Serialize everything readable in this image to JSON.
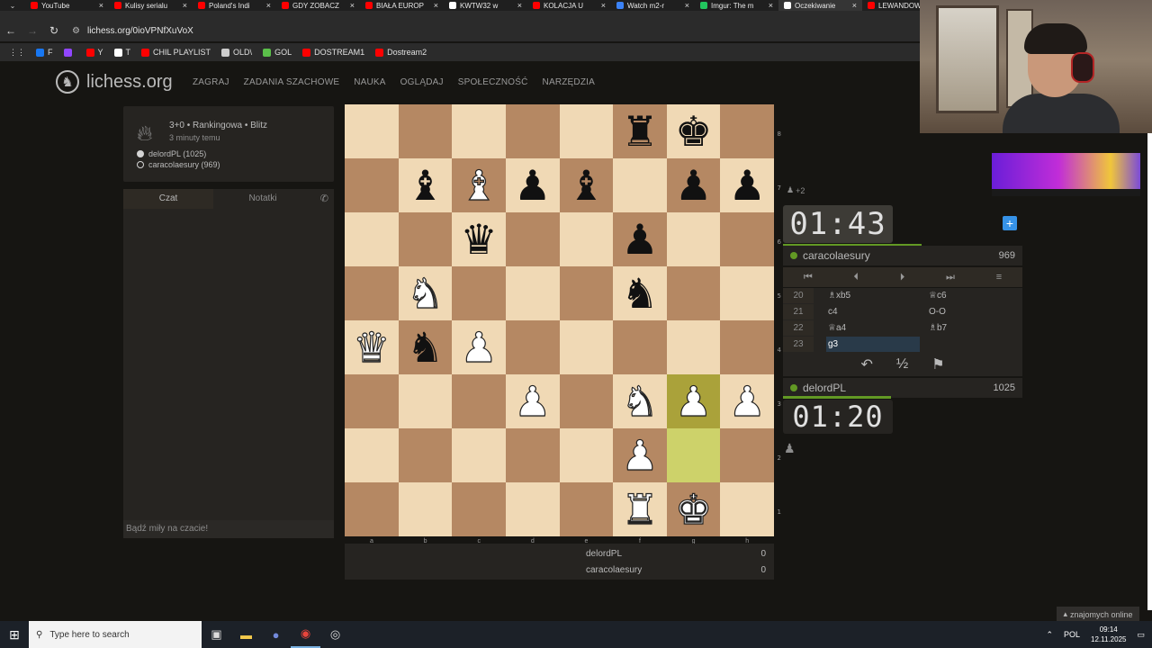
{
  "browser": {
    "tabs": [
      {
        "label": "YouTube",
        "color": "#ff0000",
        "active": false
      },
      {
        "label": "Kulisy serialu",
        "color": "#ff0000",
        "active": false
      },
      {
        "label": "Poland's Indi",
        "color": "#ff0000",
        "active": false
      },
      {
        "label": "GDY ZOBACZ",
        "color": "#ff0000",
        "active": false
      },
      {
        "label": "BIAŁA EUROP",
        "color": "#ff0000",
        "active": false
      },
      {
        "label": "KWTW32 w",
        "color": "#ffffff",
        "active": false
      },
      {
        "label": "KOLACJA U",
        "color": "#ff0000",
        "active": false
      },
      {
        "label": "Watch m2-r",
        "color": "#3b82f6",
        "active": false
      },
      {
        "label": "Imgur: The m",
        "color": "#22c55e",
        "active": false
      },
      {
        "label": "Oczekiwanie",
        "color": "#ffffff",
        "active": true
      },
      {
        "label": "LEWANDOW",
        "color": "#ff0000",
        "active": false
      }
    ],
    "url": "lichess.org/0ioVPNfXuVoX",
    "bookmarks": [
      {
        "label": "F",
        "color": "#1877f2"
      },
      {
        "label": "",
        "color": "#9146ff"
      },
      {
        "label": "Y",
        "color": "#ff0000"
      },
      {
        "label": "T",
        "color": "#ffffff"
      },
      {
        "label": "CHIL PLAYLIST",
        "color": "#ff0000"
      },
      {
        "label": "OLD\\",
        "color": "#cccccc"
      },
      {
        "label": "GOL",
        "color": "#5bbf4a"
      },
      {
        "label": "DOSTREAM1",
        "color": "#ff0000"
      },
      {
        "label": "Dostream2",
        "color": "#ff0000"
      }
    ]
  },
  "site": {
    "logo": "lichess.org",
    "nav": [
      "ZAGRAJ",
      "ZADANIA SZACHOWE",
      "NAUKA",
      "OGLĄDAJ",
      "SPOŁECZNOŚĆ",
      "NARZĘDZIA"
    ]
  },
  "game_info": {
    "setup": "3+0 • Rankingowa • Blitz",
    "ago": "3 minuty temu",
    "white": "delordPL (1025)",
    "black": "caracolaesury (969)"
  },
  "chat": {
    "tab_chat": "Czat",
    "tab_notes": "Notatki",
    "footer": "Bądź miły na czacie!"
  },
  "board": {
    "ranks": [
      "8",
      "7",
      "6",
      "5",
      "4",
      "3",
      "2",
      "1"
    ],
    "files": [
      "a",
      "b",
      "c",
      "d",
      "e",
      "f",
      "g",
      "h"
    ],
    "position": [
      [
        "",
        "",
        "",
        "",
        "",
        "r",
        "k",
        ""
      ],
      [
        "",
        "b",
        "B",
        "p",
        "b",
        "",
        "p",
        "p"
      ],
      [
        "",
        "",
        "q",
        "",
        "",
        "p",
        "",
        ""
      ],
      [
        "",
        "N",
        "",
        "",
        "",
        "n",
        "",
        ""
      ],
      [
        "Q",
        "n",
        "P",
        "",
        "",
        "",
        "",
        ""
      ],
      [
        "",
        "",
        "",
        "P",
        "",
        "N",
        "P",
        "P"
      ],
      [
        "",
        "",
        "",
        "",
        "",
        "P",
        "",
        ""
      ],
      [
        "",
        "",
        "",
        "",
        "",
        "R",
        "K",
        ""
      ]
    ],
    "highlight": [
      "g3",
      "g2"
    ]
  },
  "material": {
    "white_name": "delordPL",
    "white_score": "0",
    "black_name": "caracolaesury",
    "black_score": "0"
  },
  "opponent": {
    "clock": "01:43",
    "name": "caracolaesury",
    "rating": "969",
    "captured": "+2"
  },
  "player": {
    "clock": "01:20",
    "name": "delordPL",
    "rating": "1025"
  },
  "moves": [
    {
      "num": "20",
      "white": "♗xb5",
      "black": "♕c6"
    },
    {
      "num": "21",
      "white": "c4",
      "black": "O-O"
    },
    {
      "num": "22",
      "white": "♕a4",
      "black": "♗b7"
    },
    {
      "num": "23",
      "white": "g3",
      "black": ""
    }
  ],
  "actions": {
    "takeback": "↶",
    "draw": "½",
    "resign": "⚑"
  },
  "online": "znajomych online",
  "taskbar": {
    "search_placeholder": "Type here to search",
    "lang": "POL",
    "time": "09:14",
    "date": "12.11.2025"
  }
}
